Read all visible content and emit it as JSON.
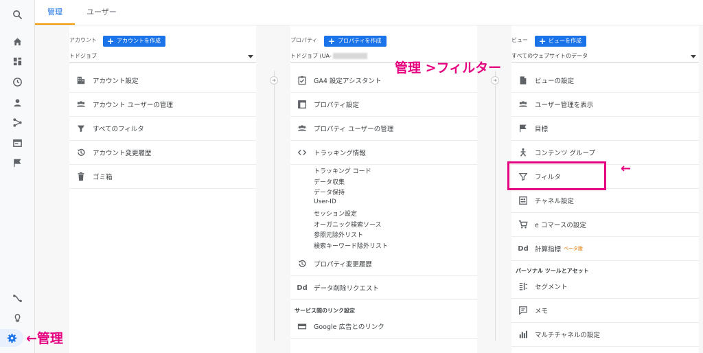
{
  "tabs": [
    {
      "label": "管理"
    },
    {
      "label": "ユーザー"
    }
  ],
  "account": {
    "heading": "アカウント",
    "create_label": "アカウントを作成",
    "selected": "トドジョブ",
    "items": [
      {
        "label": "アカウント設定",
        "icon": "building-icon"
      },
      {
        "label": "アカウント ユーザーの管理",
        "icon": "people-icon"
      },
      {
        "label": "すべてのフィルタ",
        "icon": "filter-icon"
      },
      {
        "label": "アカウント変更履歴",
        "icon": "history-icon"
      },
      {
        "label": "ゴミ箱",
        "icon": "trash-icon"
      }
    ]
  },
  "property": {
    "heading": "プロパティ",
    "create_label": "プロパティを作成",
    "selected": "トドジョブ (UA-",
    "items": [
      {
        "label": "GA4 設定アシスタント",
        "icon": "checklist-icon"
      },
      {
        "label": "プロパティ設定",
        "icon": "window-icon"
      },
      {
        "label": "プロパティ ユーザーの管理",
        "icon": "people-icon"
      },
      {
        "label": "トラッキング情報",
        "icon": "code-icon"
      }
    ],
    "tracking_sub": [
      "トラッキング コード",
      "データ収集",
      "データ保持",
      "User-ID",
      "セッション設定",
      "オーガニック検索ソース",
      "参照元除外リスト",
      "検索キーワード除外リスト"
    ],
    "items2": [
      {
        "label": "プロパティ変更履歴",
        "icon": "history-icon"
      },
      {
        "label": "データ削除リクエスト",
        "icon": "dd-icon"
      }
    ],
    "links_heading": "サービス間のリンク設定",
    "link_items": [
      {
        "label": "Google 広告とのリンク",
        "icon": "ads-icon"
      }
    ]
  },
  "view": {
    "heading": "ビュー",
    "create_label": "ビューを作成",
    "selected": "すべてのウェブサイトのデータ",
    "items": [
      {
        "label": "ビューの設定",
        "icon": "document-icon"
      },
      {
        "label": "ユーザー管理を表示",
        "icon": "people-icon"
      },
      {
        "label": "目標",
        "icon": "flag-icon"
      },
      {
        "label": "コンテンツ グループ",
        "icon": "content-group-icon"
      },
      {
        "label": "フィルタ",
        "icon": "filter-icon"
      },
      {
        "label": "チャネル設定",
        "icon": "channel-icon"
      },
      {
        "label": "e コマースの設定",
        "icon": "cart-icon"
      },
      {
        "label": "計算指標",
        "icon": "dd-icon",
        "badge": "ベータ版"
      }
    ],
    "personal_heading": "パーソナル ツールとアセット",
    "personal_items": [
      {
        "label": "セグメント",
        "icon": "segment-icon"
      },
      {
        "label": "メモ",
        "icon": "memo-icon"
      },
      {
        "label": "マルチチャネルの設定",
        "icon": "bar-chart-icon"
      }
    ]
  },
  "annotations": {
    "top": "管理 >フィルター",
    "arrow": "←",
    "bottom": "←管理"
  },
  "colors": {
    "accent": "#1a73e8",
    "highlight": "#e5007f",
    "tab_underline": "#f29900"
  }
}
